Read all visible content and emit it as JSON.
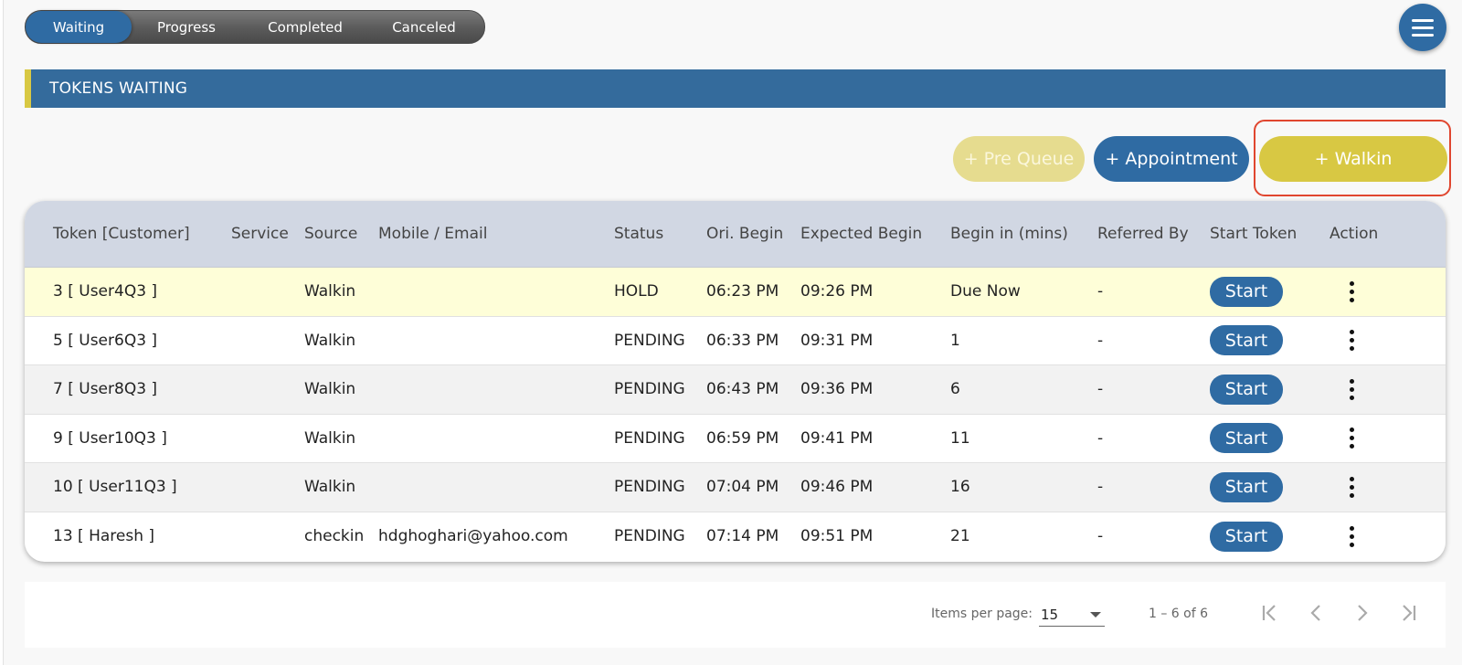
{
  "tabs": [
    {
      "label": "Waiting",
      "active": true
    },
    {
      "label": "Progress"
    },
    {
      "label": "Completed"
    },
    {
      "label": "Canceled"
    }
  ],
  "section_title": "TOKENS WAITING",
  "actions": {
    "prequeue_label": "+ Pre Queue",
    "appointment_label": "+ Appointment",
    "walkin_label": "+ Walkin"
  },
  "table": {
    "headers": [
      "Token [Customer]",
      "Service",
      "Source",
      "Mobile / Email",
      "Status",
      "Ori. Begin",
      "Expected Begin",
      "Begin in (mins)",
      "Referred By",
      "Start Token",
      "Action"
    ],
    "start_label": "Start",
    "rows": [
      {
        "token": "3 [ User4Q3 ]",
        "service": "",
        "source": "Walkin",
        "contact": "",
        "status": "HOLD",
        "ori_begin": "06:23 PM",
        "expected_begin": "09:26 PM",
        "begin_in": "Due Now",
        "referred_by": "-"
      },
      {
        "token": "5 [ User6Q3 ]",
        "service": "",
        "source": "Walkin",
        "contact": "",
        "status": "PENDING",
        "ori_begin": "06:33 PM",
        "expected_begin": "09:31 PM",
        "begin_in": "1",
        "referred_by": "-"
      },
      {
        "token": "7 [ User8Q3 ]",
        "service": "",
        "source": "Walkin",
        "contact": "",
        "status": "PENDING",
        "ori_begin": "06:43 PM",
        "expected_begin": "09:36 PM",
        "begin_in": "6",
        "referred_by": "-"
      },
      {
        "token": "9 [ User10Q3 ]",
        "service": "",
        "source": "Walkin",
        "contact": "",
        "status": "PENDING",
        "ori_begin": "06:59 PM",
        "expected_begin": "09:41 PM",
        "begin_in": "11",
        "referred_by": "-"
      },
      {
        "token": "10 [ User11Q3 ]",
        "service": "",
        "source": "Walkin",
        "contact": "",
        "status": "PENDING",
        "ori_begin": "07:04 PM",
        "expected_begin": "09:46 PM",
        "begin_in": "16",
        "referred_by": "-"
      },
      {
        "token": "13 [ Haresh ]",
        "service": "",
        "source": "checkin",
        "contact": "hdghoghari@yahoo.com",
        "status": "PENDING",
        "ori_begin": "07:14 PM",
        "expected_begin": "09:51 PM",
        "begin_in": "21",
        "referred_by": "-"
      }
    ]
  },
  "paginator": {
    "items_per_page_label": "Items per page:",
    "items_per_page_value": "15",
    "range_label": "1 – 6 of 6"
  },
  "colors": {
    "primary": "#2f6ba3",
    "accent": "#d8c843",
    "highlight": "#e0462f"
  }
}
